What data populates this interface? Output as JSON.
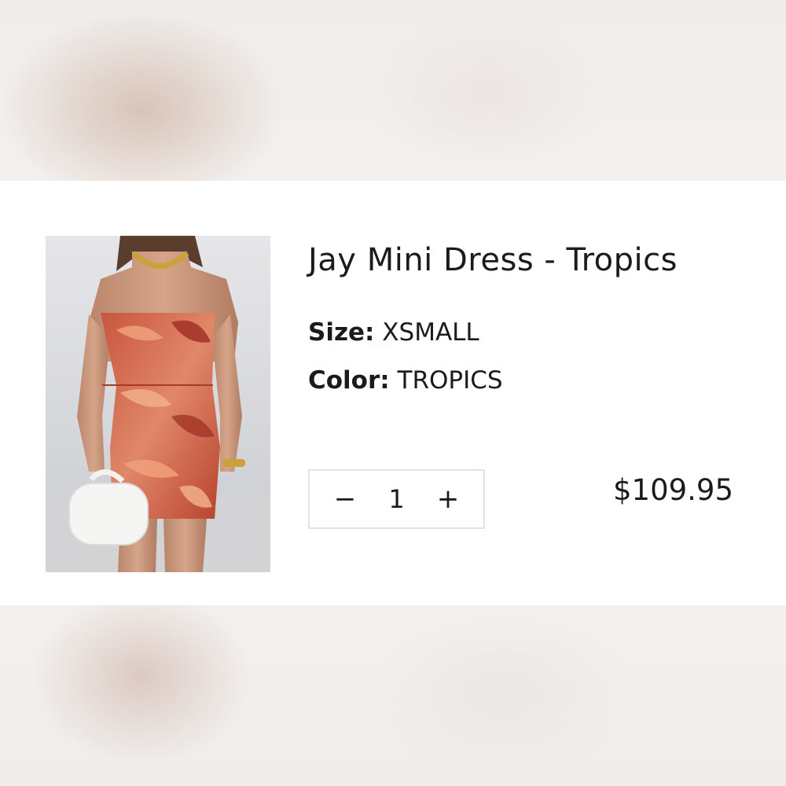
{
  "product": {
    "title": "Jay Mini Dress - Tropics",
    "image_alt_icon": "product-photo",
    "size_label": "Size:",
    "size_value": "XSMALL",
    "color_label": "Color:",
    "color_value": "TROPICS",
    "price": "$109.95"
  },
  "quantity": {
    "decrement_symbol": "−",
    "value": "1",
    "increment_symbol": "+"
  },
  "colors": {
    "card_background": "#ffffff",
    "text": "#1b1b1b",
    "border": "#e3e3e3"
  }
}
